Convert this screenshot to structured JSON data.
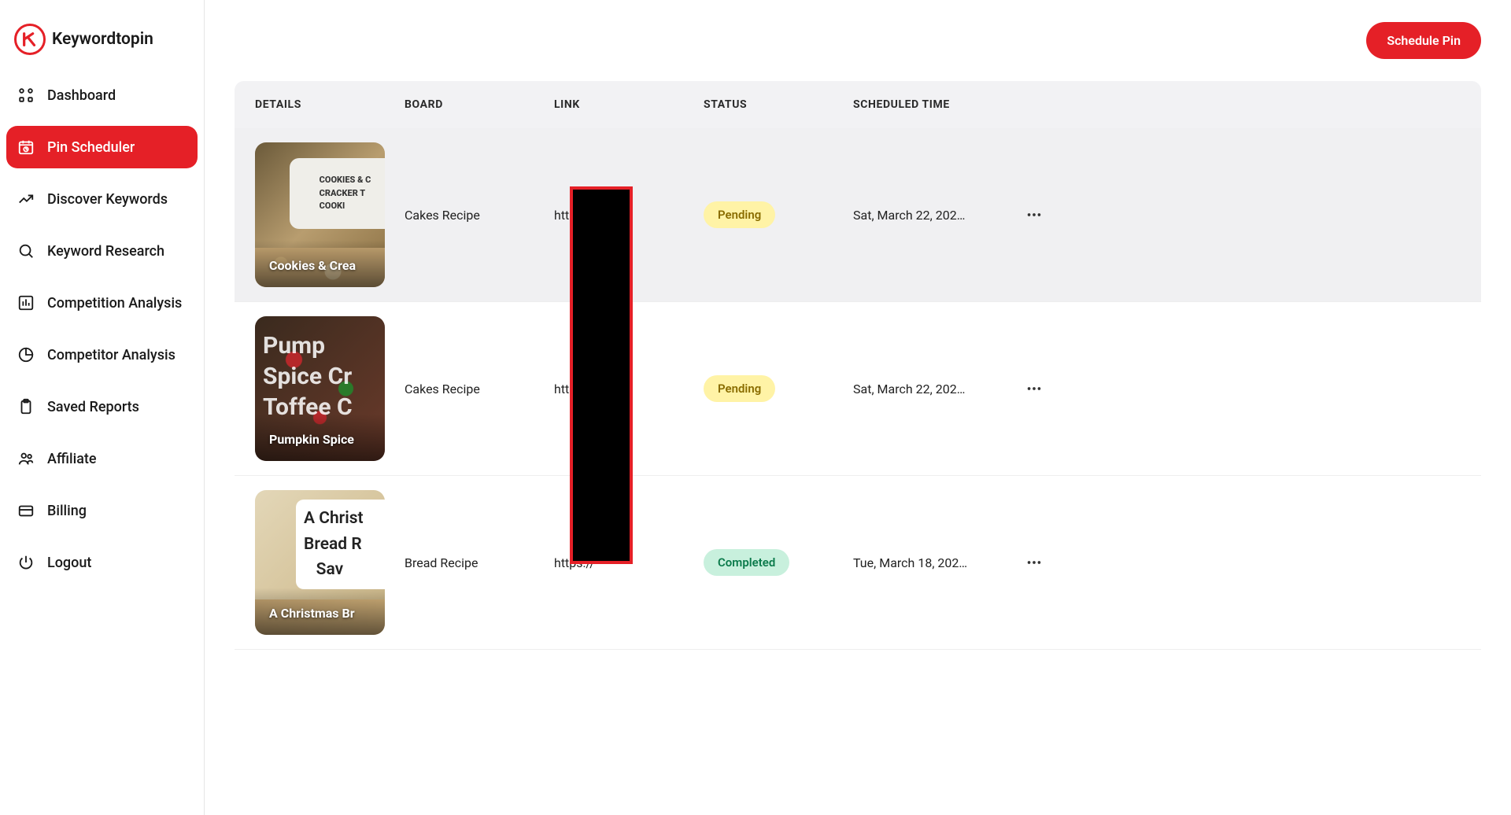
{
  "brand": {
    "name": "Keywordtopin"
  },
  "sidebar": {
    "items": [
      {
        "label": "Dashboard",
        "icon": "grid"
      },
      {
        "label": "Pin Scheduler",
        "icon": "calendar"
      },
      {
        "label": "Discover Keywords",
        "icon": "trend"
      },
      {
        "label": "Keyword Research",
        "icon": "search"
      },
      {
        "label": "Competition Analysis",
        "icon": "bar"
      },
      {
        "label": "Competitor Analysis",
        "icon": "pie"
      },
      {
        "label": "Saved Reports",
        "icon": "clipboard"
      },
      {
        "label": "Affiliate",
        "icon": "users"
      },
      {
        "label": "Billing",
        "icon": "card"
      },
      {
        "label": "Logout",
        "icon": "power"
      }
    ],
    "active_index": 1
  },
  "topbar": {
    "schedule_btn": "Schedule Pin"
  },
  "table": {
    "headers": {
      "details": "DETAILS",
      "board": "BOARD",
      "link": "LINK",
      "status": "STATUS",
      "scheduled": "SCHEDULED TIME"
    },
    "rows": [
      {
        "title": "Cookies & Crea",
        "board": "Cakes Recipe",
        "link": "https://",
        "status": "Pending",
        "status_class": "pending",
        "scheduled": "Sat, March 22, 202…",
        "hovered": true
      },
      {
        "title": "Pumpkin Spice",
        "board": "Cakes Recipe",
        "link": "https://",
        "status": "Pending",
        "status_class": "pending",
        "scheduled": "Sat, March 22, 202…",
        "hovered": false
      },
      {
        "title": "A Christmas Br",
        "board": "Bread Recipe",
        "link": "https://",
        "status": "Completed",
        "status_class": "completed",
        "scheduled": "Tue, March 18, 202…",
        "hovered": false
      }
    ]
  }
}
